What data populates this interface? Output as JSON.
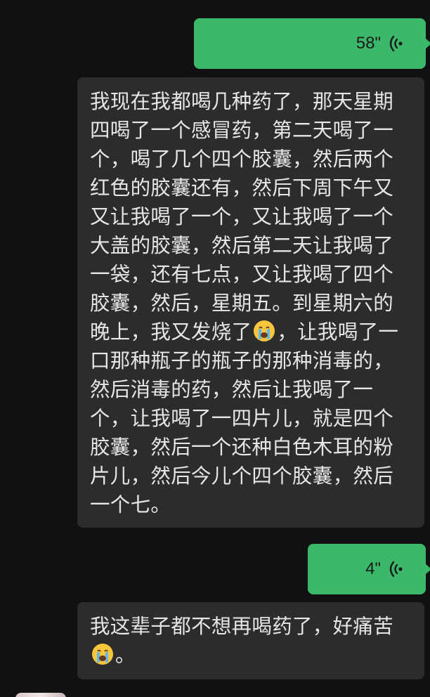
{
  "colors": {
    "background": "#111111",
    "outgoing_bubble": "#3cb86a",
    "incoming_bubble": "#2c2c2c",
    "incoming_text": "#e6e6e6"
  },
  "messages": [
    {
      "type": "voice",
      "direction": "outgoing",
      "duration": "58\"",
      "icon": "voice-wave-icon"
    },
    {
      "type": "text",
      "direction": "incoming",
      "text": "我现在我都喝几种药了，那天星期四喝了一个感冒药，第二天喝了一个，喝了几个四个胶囊，然后两个红色的胶囊还有，然后下周下午又又让我喝了一个，又让我喝了一个大盖的胶囊，然后第二天让我喝了一袋，还有七点，又让我喝了四个胶囊，然后，星期五。到星期六的晚上，我又发烧了",
      "emoji": "crying-face-emoji",
      "text_after": "，让我喝了一口那种瓶子的瓶子的那种消毒的，然后消毒的药，然后让我喝了一个，让我喝了一四片儿，就是四个胶囊，然后一个还种白色木耳的粉片儿，然后今儿个四个胶囊，然后一个七。"
    },
    {
      "type": "voice",
      "direction": "outgoing",
      "duration": "4\"",
      "icon": "voice-wave-icon"
    },
    {
      "type": "text",
      "direction": "incoming",
      "text": "我这辈子都不想再喝药了，好痛苦",
      "emoji": "crying-face-emoji",
      "text_after": "。"
    }
  ]
}
